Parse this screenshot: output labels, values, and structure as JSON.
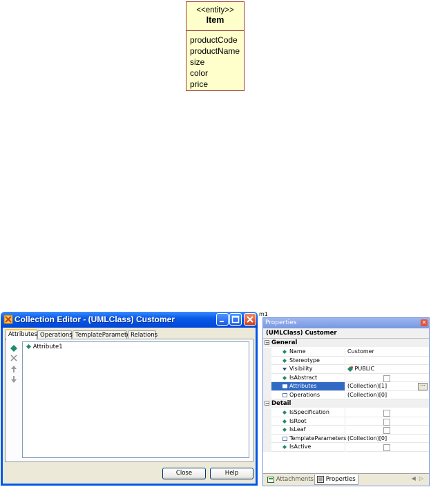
{
  "uml_entity": {
    "stereotype": "<<entity>>",
    "name": "Item",
    "attributes": [
      "productCode",
      "productName",
      "size",
      "color",
      "price"
    ]
  },
  "collection_editor": {
    "title": "Collection Editor - (UMLClass) Customer",
    "tabs": [
      "Attributes",
      "Operations",
      "TemplateParameters",
      "Relations"
    ],
    "active_tab": "Attributes",
    "side_tools": [
      "add-icon",
      "delete-icon",
      "move-up-icon",
      "move-down-icon"
    ],
    "items": [
      "Attribute1"
    ],
    "buttons": {
      "close": "Close",
      "help": "Help"
    }
  },
  "background_label": "m1",
  "properties": {
    "title": "Properties",
    "object": "(UMLClass) Customer",
    "categories": {
      "general": "General",
      "detail": "Detail"
    },
    "general_rows": [
      {
        "name": "Name",
        "value": "Customer"
      },
      {
        "name": "Stereotype",
        "value": ""
      },
      {
        "name": "Visibility",
        "value": "PUBLIC"
      },
      {
        "name": "IsAbstract",
        "value": ""
      },
      {
        "name": "Attributes",
        "value": "(Collection)[1]"
      },
      {
        "name": "Operations",
        "value": "(Collection)[0]"
      }
    ],
    "detail_rows": [
      {
        "name": "IsSpecification",
        "value": ""
      },
      {
        "name": "IsRoot",
        "value": ""
      },
      {
        "name": "IsLeaf",
        "value": ""
      },
      {
        "name": "TemplateParameters",
        "value": "(Collection)[0]"
      },
      {
        "name": "IsActive",
        "value": ""
      }
    ],
    "bottom_tabs": [
      "Attachments",
      "Properties"
    ]
  },
  "colors": {
    "uml_fill": "#ffffcc",
    "uml_border": "#9a3a3a",
    "xp_title": "#0a5ae8",
    "selection": "#316ac5",
    "diamond": "#1e8b6e"
  }
}
